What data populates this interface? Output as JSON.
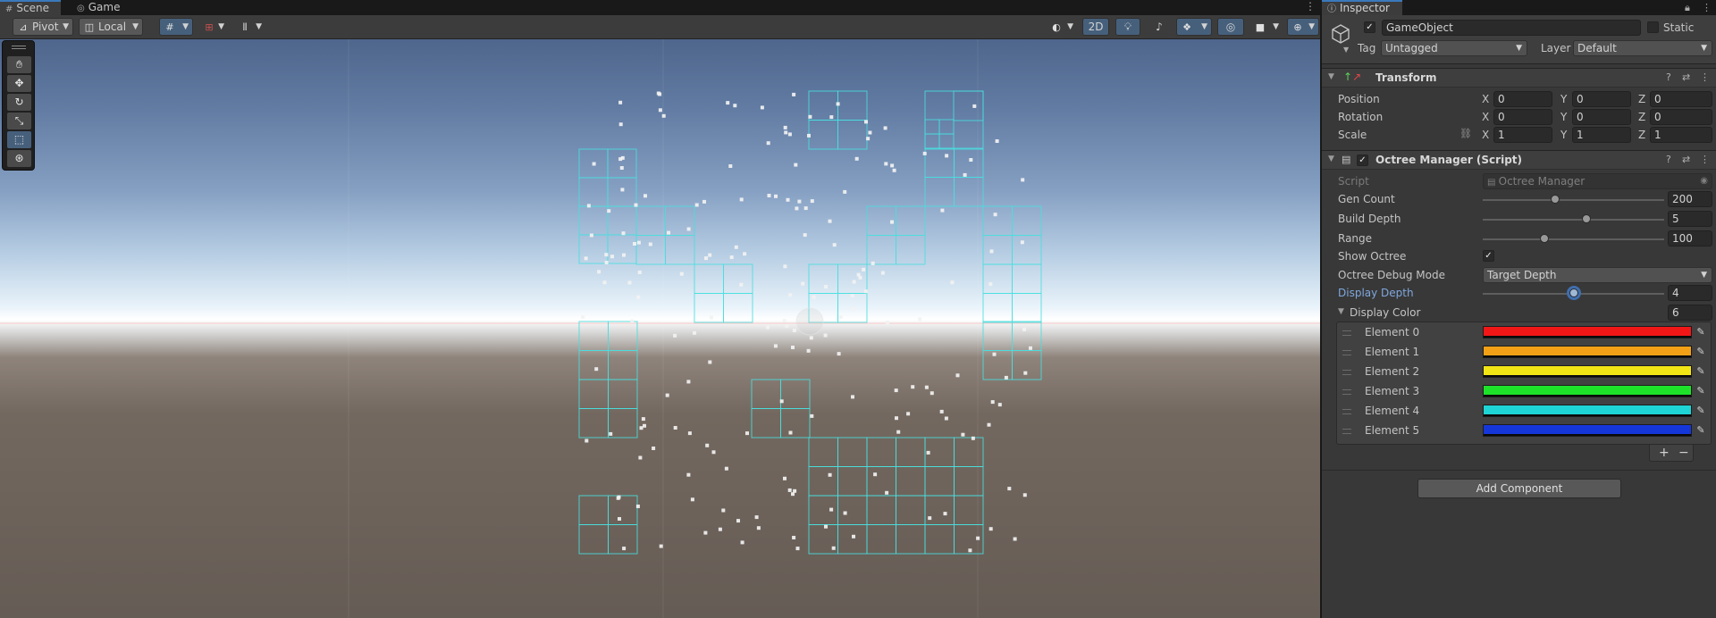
{
  "scene_tabs": [
    {
      "label": "Scene",
      "icon": "scene-hash-icon"
    },
    {
      "label": "Game",
      "icon": "gamepad-icon"
    }
  ],
  "scene_toolbar": {
    "pivot_label": "Pivot",
    "local_label": "Local",
    "mode_2d_label": "2D"
  },
  "inspector": {
    "tab_label": "Inspector",
    "gameobject": {
      "name": "GameObject",
      "active": true,
      "static_label": "Static",
      "tag_label": "Tag",
      "tag_value": "Untagged",
      "layer_label": "Layer",
      "layer_value": "Default"
    },
    "transform": {
      "title": "Transform",
      "position_label": "Position",
      "rotation_label": "Rotation",
      "scale_label": "Scale",
      "position": {
        "x": "0",
        "y": "0",
        "z": "0"
      },
      "rotation": {
        "x": "0",
        "y": "0",
        "z": "0"
      },
      "scale": {
        "x": "1",
        "y": "1",
        "z": "1"
      },
      "axes": {
        "x": "X",
        "y": "Y",
        "z": "Z"
      }
    },
    "octree_manager": {
      "title": "Octree Manager (Script)",
      "script_label": "Script",
      "script_value": "Octree Manager",
      "gen_count_label": "Gen Count",
      "gen_count_value": "200",
      "gen_count_fraction": 0.4,
      "build_depth_label": "Build Depth",
      "build_depth_value": "5",
      "build_depth_fraction": 0.57,
      "range_label": "Range",
      "range_value": "100",
      "range_fraction": 0.34,
      "show_octree_label": "Show Octree",
      "show_octree": true,
      "debug_mode_label": "Octree Debug Mode",
      "debug_mode_value": "Target Depth",
      "display_depth_label": "Display Depth",
      "display_depth_value": "4",
      "display_depth_fraction": 0.5,
      "display_color_label": "Display Color",
      "display_color_count": "6",
      "colors": [
        {
          "label": "Element 0",
          "hex": "#f21717"
        },
        {
          "label": "Element 1",
          "hex": "#f2a116"
        },
        {
          "label": "Element 2",
          "hex": "#f2e515"
        },
        {
          "label": "Element 3",
          "hex": "#1ee22a"
        },
        {
          "label": "Element 4",
          "hex": "#1ed4d4"
        },
        {
          "label": "Element 5",
          "hex": "#1537d9"
        }
      ]
    },
    "add_component_label": "Add Component"
  },
  "accent_color": "#3a79bb",
  "octree_line_color": "#49dede"
}
